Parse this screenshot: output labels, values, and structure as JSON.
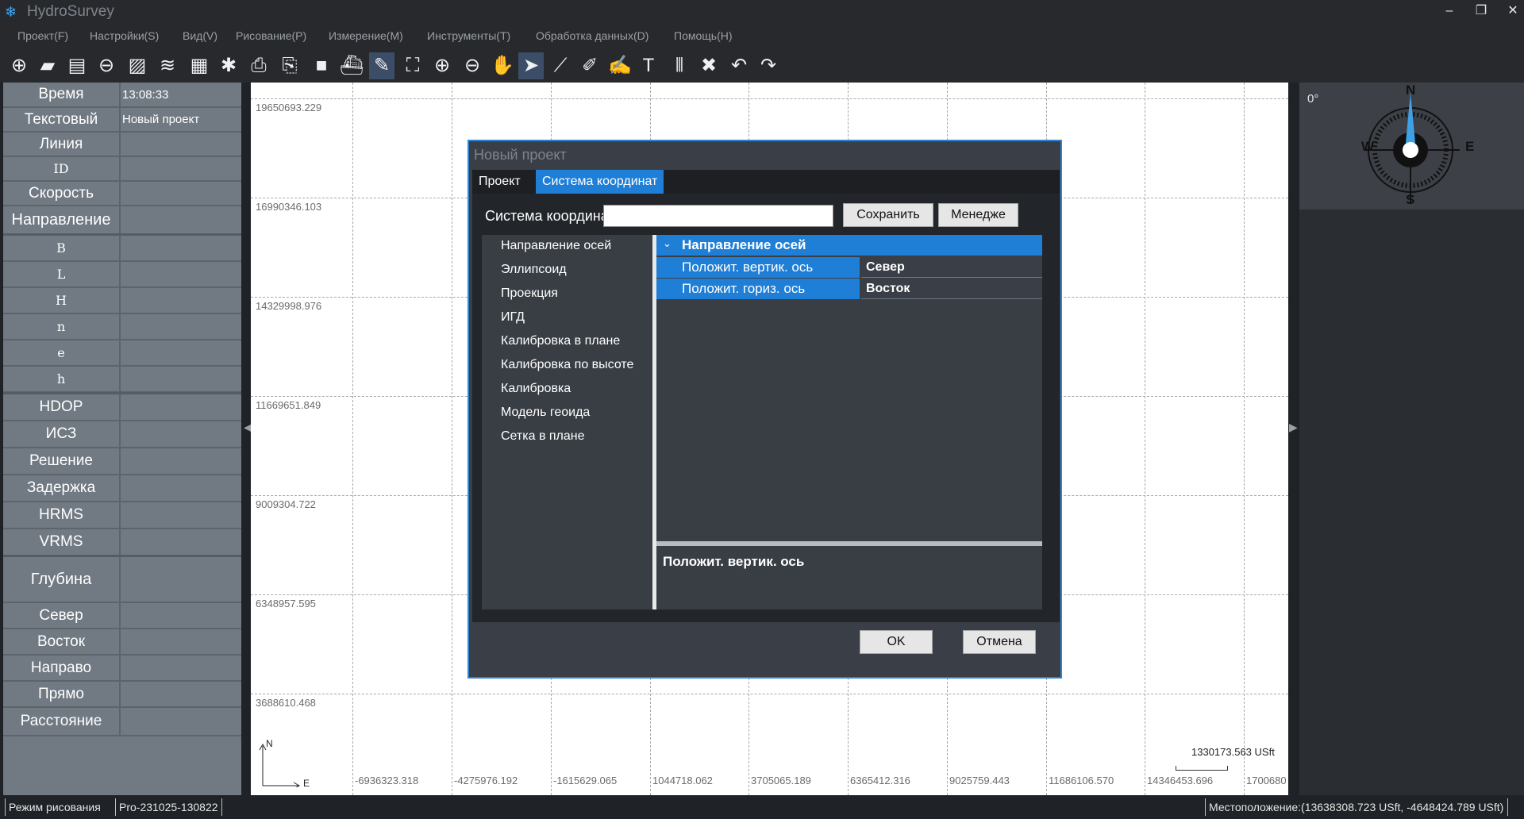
{
  "app": {
    "title": "HydroSurvey",
    "icon": "snowflake-icon"
  },
  "window_controls": {
    "minimize": "–",
    "restore": "❐",
    "close": "✕"
  },
  "menu": [
    "Проект(F)",
    "Настройки(S)",
    "Вид(V)",
    "Рисование(P)",
    "Измерение(M)",
    "Инструменты(T)",
    "Обработка данных(D)",
    "Помощь(H)"
  ],
  "toolbar_icons": [
    "new-project-icon",
    "open-project-icon",
    "save-icon",
    "link-icon",
    "image-icon",
    "layers-icon",
    "document-icon",
    "settings-icon",
    "printer-icon",
    "print-setup-icon",
    "video-icon",
    "boat-icon",
    "edit-icon",
    "fullscreen-icon",
    "zoom-in-icon",
    "zoom-out-icon",
    "pan-hand-icon",
    "select-arrow-icon",
    "ruler-icon",
    "edit-points-icon",
    "edit-lines-icon",
    "text-tool-icon",
    "barcode-icon",
    "delete-icon",
    "undo-icon",
    "redo-icon"
  ],
  "left_panel": {
    "rows": [
      {
        "label": "Время",
        "value": "13:08:33"
      },
      {
        "label": "Текстовый",
        "value": "Новый проект"
      },
      {
        "label": "Линия",
        "value": ""
      },
      {
        "label": "ID",
        "value": ""
      },
      {
        "label": "Скорость",
        "value": ""
      },
      {
        "label": "Направление",
        "value": ""
      },
      {
        "label": "B",
        "value": ""
      },
      {
        "label": "L",
        "value": ""
      },
      {
        "label": "H",
        "value": ""
      },
      {
        "label": "n",
        "value": ""
      },
      {
        "label": "e",
        "value": ""
      },
      {
        "label": "h",
        "value": ""
      },
      {
        "label": "HDOP",
        "value": ""
      },
      {
        "label": "ИСЗ",
        "value": ""
      },
      {
        "label": "Решение",
        "value": ""
      },
      {
        "label": "Задержка",
        "value": ""
      },
      {
        "label": "HRMS",
        "value": ""
      },
      {
        "label": "VRMS",
        "value": ""
      },
      {
        "label": "Глубина",
        "value": ""
      },
      {
        "label": "Север",
        "value": ""
      },
      {
        "label": "Восток",
        "value": ""
      },
      {
        "label": "Направо",
        "value": ""
      },
      {
        "label": "Прямо",
        "value": ""
      },
      {
        "label": "Расстояние",
        "value": ""
      }
    ]
  },
  "map": {
    "y_labels": [
      "19650693.229",
      "16990346.103",
      "14329998.976",
      "11669651.849",
      "9009304.722",
      "6348957.595",
      "3688610.468"
    ],
    "x_labels": [
      "-6936323.318",
      "-4275976.192",
      "-1615629.065",
      "1044718.062",
      "3705065.189",
      "6365412.316",
      "9025759.443",
      "11686106.570",
      "14346453.696",
      "1700680"
    ],
    "axis_n": "N",
    "axis_e": "E",
    "scale_label": "1330173.563 USft"
  },
  "compass": {
    "angle": "0°",
    "n": "N",
    "s": "S",
    "e": "E",
    "w": "W"
  },
  "dialog": {
    "title": "Новый проект",
    "tabs": [
      "Проект",
      "Система координат"
    ],
    "cs_label": "Система координат",
    "cs_value": "",
    "save_button": "Сохранить",
    "manager_button": "Менедже",
    "tree": [
      "Направление осей",
      "Эллипсоид",
      "Проекция",
      "ИГД",
      "Калибровка в плане",
      "Калибровка по высоте",
      "Калибровка",
      "Модель геоида",
      "Сетка в плане"
    ],
    "prop_group": "Направление осей",
    "props": [
      {
        "name": "Положит. вертик. ось",
        "value": "Север"
      },
      {
        "name": "Положит. гориз. ось",
        "value": "Восток"
      }
    ],
    "description_title": "Положит. вертик. ось",
    "ok_button": "OK",
    "cancel_button": "Отмена"
  },
  "statusbar": {
    "mode": "Режим рисования",
    "version": "Pro-231025-130822",
    "location": "Местоположение:(13638308.723 USft, -4648424.789 USft)"
  }
}
